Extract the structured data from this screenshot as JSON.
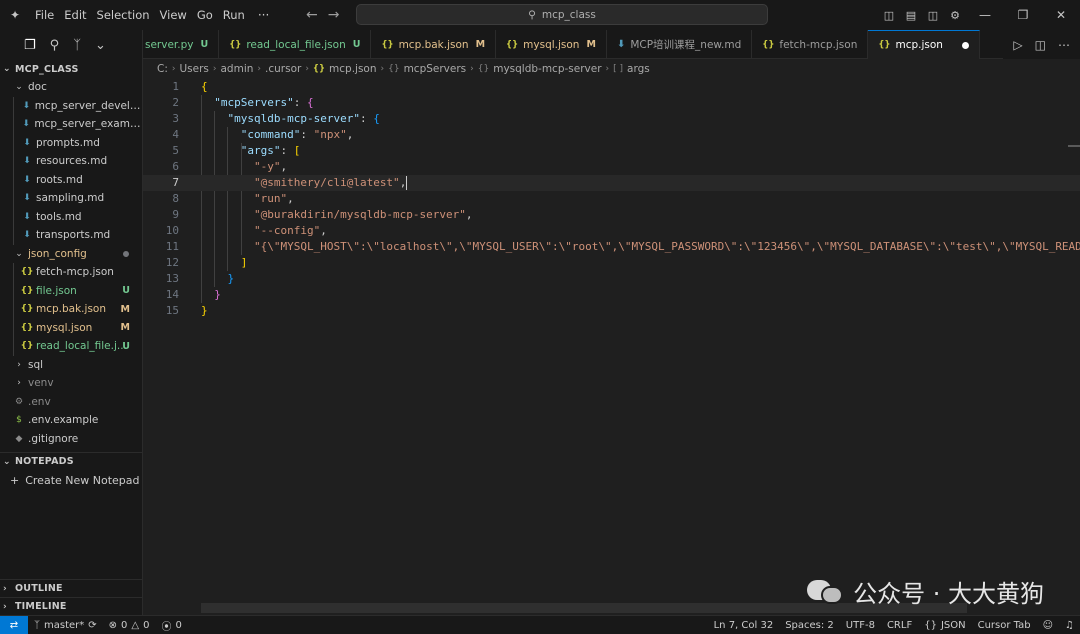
{
  "app": {
    "logo_icon": "vscode-logo-icon"
  },
  "menu": [
    "File",
    "Edit",
    "Selection",
    "View",
    "Go",
    "Run"
  ],
  "menu_more": "···",
  "command_center": {
    "text": "mcp_class",
    "icon": "search-icon"
  },
  "sidebar": {
    "root": "MCP_CLASS",
    "tree": [
      {
        "label": "doc",
        "type": "folder",
        "expanded": true
      },
      {
        "label": "mcp_server_develop...",
        "type": "md"
      },
      {
        "label": "mcp_server_example...",
        "type": "md"
      },
      {
        "label": "prompts.md",
        "type": "md"
      },
      {
        "label": "resources.md",
        "type": "md"
      },
      {
        "label": "roots.md",
        "type": "md"
      },
      {
        "label": "sampling.md",
        "type": "md"
      },
      {
        "label": "tools.md",
        "type": "md"
      },
      {
        "label": "transports.md",
        "type": "md"
      },
      {
        "label": "json_config",
        "type": "folder",
        "expanded": true
      },
      {
        "label": "fetch-mcp.json",
        "type": "json"
      },
      {
        "label": "file.json",
        "type": "json",
        "status": "U"
      },
      {
        "label": "mcp.bak.json",
        "type": "json",
        "status": "M"
      },
      {
        "label": "mysql.json",
        "type": "json",
        "status": "M"
      },
      {
        "label": "read_local_file.j...",
        "type": "json",
        "status": "U"
      },
      {
        "label": "sql",
        "type": "folder"
      },
      {
        "label": "venv",
        "type": "folder"
      },
      {
        "label": ".env",
        "type": "env"
      },
      {
        "label": ".env.example",
        "type": "dollar"
      },
      {
        "label": ".gitignore",
        "type": "git"
      }
    ],
    "notepads_header": "NOTEPADS",
    "create_notepad": "Create New Notepad",
    "outline_header": "OUTLINE",
    "timeline_header": "TIMELINE"
  },
  "tabs": [
    {
      "label": "server.py",
      "status": "U"
    },
    {
      "label": "read_local_file.json",
      "status": "U"
    },
    {
      "label": "mcp.bak.json",
      "status": "M"
    },
    {
      "label": "mysql.json",
      "status": "M"
    },
    {
      "label": "MCP培训课程_new.md",
      "status": ""
    },
    {
      "label": "fetch-mcp.json",
      "status": ""
    },
    {
      "label": "mcp.json",
      "status": "",
      "active": true
    }
  ],
  "breadcrumb": [
    "C:",
    "Users",
    "admin",
    ".cursor",
    "mcp.json",
    "mcpServers",
    "mysqldb-mcp-server",
    "args"
  ],
  "code": {
    "current_line": 7,
    "lines": [
      {
        "n": "1",
        "tokens": [
          {
            "t": "{",
            "c": "b1"
          }
        ]
      },
      {
        "n": "2",
        "tokens": [
          {
            "t": "  ",
            "c": "p"
          },
          {
            "t": "\"mcpServers\"",
            "c": "k"
          },
          {
            "t": ": ",
            "c": "p"
          },
          {
            "t": "{",
            "c": "b2"
          }
        ]
      },
      {
        "n": "3",
        "tokens": [
          {
            "t": "    ",
            "c": "p"
          },
          {
            "t": "\"mysqldb-mcp-server\"",
            "c": "k"
          },
          {
            "t": ": ",
            "c": "p"
          },
          {
            "t": "{",
            "c": "b3"
          }
        ]
      },
      {
        "n": "4",
        "tokens": [
          {
            "t": "      ",
            "c": "p"
          },
          {
            "t": "\"command\"",
            "c": "k"
          },
          {
            "t": ": ",
            "c": "p"
          },
          {
            "t": "\"npx\"",
            "c": "s"
          },
          {
            "t": ",",
            "c": "p"
          }
        ]
      },
      {
        "n": "5",
        "tokens": [
          {
            "t": "      ",
            "c": "p"
          },
          {
            "t": "\"args\"",
            "c": "k"
          },
          {
            "t": ": ",
            "c": "p"
          },
          {
            "t": "[",
            "c": "b1"
          }
        ]
      },
      {
        "n": "6",
        "tokens": [
          {
            "t": "        ",
            "c": "p"
          },
          {
            "t": "\"-y\"",
            "c": "s"
          },
          {
            "t": ",",
            "c": "p"
          }
        ]
      },
      {
        "n": "7",
        "tokens": [
          {
            "t": "        ",
            "c": "p"
          },
          {
            "t": "\"@smithery/cli@latest\"",
            "c": "s"
          },
          {
            "t": ",",
            "c": "p"
          }
        ]
      },
      {
        "n": "8",
        "tokens": [
          {
            "t": "        ",
            "c": "p"
          },
          {
            "t": "\"run\"",
            "c": "s"
          },
          {
            "t": ",",
            "c": "p"
          }
        ]
      },
      {
        "n": "9",
        "tokens": [
          {
            "t": "        ",
            "c": "p"
          },
          {
            "t": "\"@burakdirin/mysqldb-mcp-server\"",
            "c": "s"
          },
          {
            "t": ",",
            "c": "p"
          }
        ]
      },
      {
        "n": "10",
        "tokens": [
          {
            "t": "        ",
            "c": "p"
          },
          {
            "t": "\"--config\"",
            "c": "s"
          },
          {
            "t": ",",
            "c": "p"
          }
        ]
      },
      {
        "n": "11",
        "tokens": [
          {
            "t": "        ",
            "c": "p"
          },
          {
            "t": "\"{\\\"MYSQL_HOST\\\":\\\"localhost\\\",\\\"MYSQL_USER\\\":\\\"root\\\",\\\"MYSQL_PASSWORD\\\":\\\"123456\\\",\\\"MYSQL_DATABASE\\\":\\\"test\\\",\\\"MYSQL_READONLY\\\":\\\"true\\\"}\"",
            "c": "s"
          }
        ]
      },
      {
        "n": "12",
        "tokens": [
          {
            "t": "      ",
            "c": "p"
          },
          {
            "t": "]",
            "c": "b1"
          }
        ]
      },
      {
        "n": "13",
        "tokens": [
          {
            "t": "    ",
            "c": "p"
          },
          {
            "t": "}",
            "c": "b3"
          }
        ]
      },
      {
        "n": "14",
        "tokens": [
          {
            "t": "  ",
            "c": "p"
          },
          {
            "t": "}",
            "c": "b2"
          }
        ]
      },
      {
        "n": "15",
        "tokens": [
          {
            "t": "}",
            "c": "b1"
          }
        ]
      }
    ]
  },
  "watermark": "公众号 · 大大黄狗",
  "statusbar": {
    "branch": "master*",
    "errors": "0",
    "warnings": "0",
    "ports": "0",
    "position": "Ln 7, Col 32",
    "spaces": "Spaces: 2",
    "encoding": "UTF-8",
    "eol": "CRLF",
    "language": "JSON",
    "cursor_tab": "Cursor Tab"
  },
  "colors": {
    "accent": "#0078d4",
    "modified": "#e2c08d",
    "untracked": "#73c991",
    "json_icon": "#cbcb41",
    "md_icon": "#519aba"
  }
}
